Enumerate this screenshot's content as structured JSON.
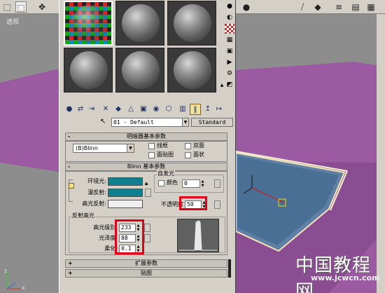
{
  "viewport": {
    "label": "透视",
    "watermark_cn": "中国教程网",
    "watermark_url": "www.jcwcn.com",
    "colors": {
      "background": "#8d8d8d",
      "floor_purple": "#9b5aa2",
      "pool_blue": "#4a6f95"
    },
    "top_toolbar_icons": [
      "select-icon",
      "move-icon",
      "curve-editor-icon",
      "schematic-icon",
      "material-editor-icon",
      "render-icon"
    ],
    "right_strip_icons": []
  },
  "material_editor": {
    "sample_slots_count": 8,
    "toolbar_icons": [
      "get-material-icon",
      "put-to-scene-icon",
      "assign-icon",
      "reset-icon",
      "copy-icon",
      "unique-icon",
      "put-to-library-icon",
      "effects-channel-icon",
      "show-map-icon",
      "show-end-result-icon",
      "go-parent-icon",
      "go-sibling-icon"
    ],
    "side_icons": [
      "sample-type-icon",
      "backlight-icon",
      "background-icon",
      "uv-tiling-icon",
      "video-check-icon",
      "make-preview-icon",
      "options-icon",
      "select-by-material-icon",
      "material-navigator-icon"
    ],
    "material_name": "01 - Default",
    "material_type_button": "Standard",
    "shader_basic": {
      "title": "明暗器基本参数",
      "shader": "(B)Blinn",
      "checkboxes": [
        {
          "label": "线框",
          "checked": false
        },
        {
          "label": "双面",
          "checked": false
        },
        {
          "label": "面贴图",
          "checked": false
        },
        {
          "label": "面状",
          "checked": false
        }
      ]
    },
    "blinn_basic": {
      "title": "Blinn 基本参数",
      "self_illum_group": "自发光",
      "color_checkbox": "颜色",
      "self_illum_value": "0",
      "ambient_label": "环境光:",
      "diffuse_label": "漫反射:",
      "specular_label": "高光反射:",
      "ambient_color": "#0e7f8c",
      "diffuse_color": "#0e7f8c",
      "specular_color": "#f0f0f0",
      "opacity_label": "不透明度",
      "opacity_value": "50"
    },
    "specular_highlights": {
      "title": "反射高光",
      "specular_level_label": "高光级别:",
      "specular_level": "233",
      "glossiness_label": "光泽度:",
      "glossiness": "88",
      "soften_label": "柔化:",
      "soften": "0.1"
    },
    "extended_params": {
      "sign": "+",
      "title": "扩展参数"
    },
    "maps": {
      "sign": "+",
      "title": "贴图"
    },
    "highlight_color": "#e0001a"
  }
}
